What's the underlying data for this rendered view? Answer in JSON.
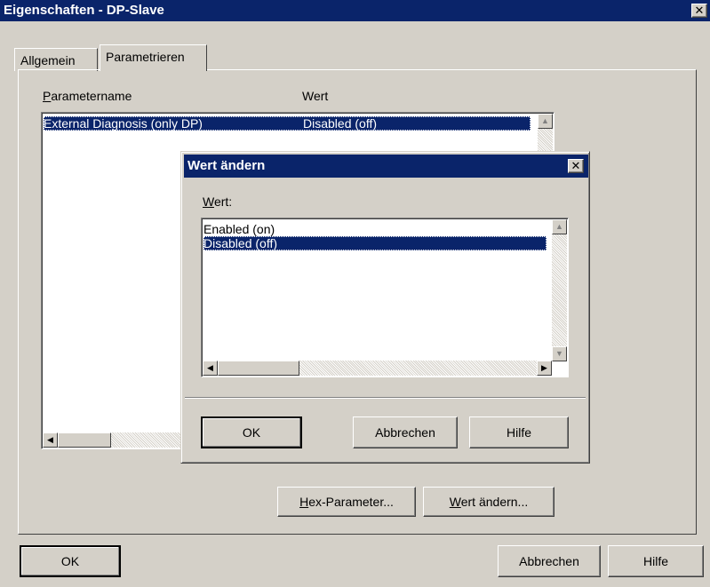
{
  "window": {
    "title": "Eigenschaften - DP-Slave",
    "close_glyph": "✕"
  },
  "tabs": [
    {
      "label": "Allgemein",
      "active": false
    },
    {
      "label": "Parametrieren",
      "active": true
    }
  ],
  "param_list": {
    "col_name_mnemonic": "P",
    "col_name_rest": "arametername",
    "col_value": "Wert",
    "rows": [
      {
        "name": "External Diagnosis (only DP)",
        "value": "Disabled (off)",
        "selected": true
      }
    ]
  },
  "buttons": {
    "hex_parameter_mnemonic": "H",
    "hex_parameter_rest": "ex-Parameter...",
    "wert_aendern_mnemonic": "W",
    "wert_aendern_rest": "ert ändern...",
    "ok": "OK",
    "abbrechen": "Abbrechen",
    "hilfe": "Hilfe"
  },
  "dialog": {
    "title": "Wert ändern",
    "close_glyph": "✕",
    "label_mnemonic": "W",
    "label_rest": "ert:",
    "options": [
      {
        "label": "Enabled (on)",
        "selected": false
      },
      {
        "label": "Disabled (off)",
        "selected": true
      }
    ],
    "ok": "OK",
    "abbrechen": "Abbrechen",
    "hilfe": "Hilfe"
  },
  "colors": {
    "titlebar": "#0a246a",
    "face": "#d4d0c8",
    "selection": "#0a246a"
  }
}
